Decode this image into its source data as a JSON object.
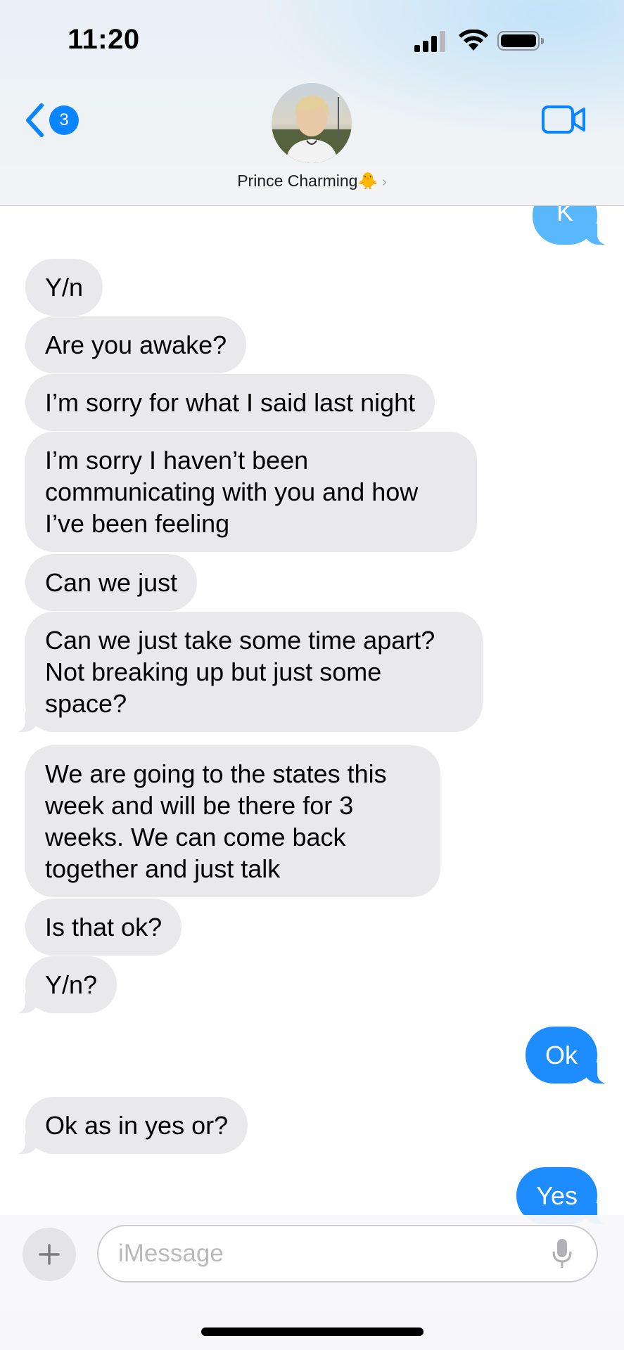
{
  "status_bar": {
    "time": "11:20"
  },
  "header": {
    "back_badge": "3",
    "contact_name": "Prince Charming🐥",
    "chevron": "›"
  },
  "messages": [
    {
      "direction": "outgoing",
      "text": "K"
    },
    {
      "direction": "incoming",
      "text": "Y/n"
    },
    {
      "direction": "incoming",
      "text": "Are you awake?"
    },
    {
      "direction": "incoming",
      "text": "I’m sorry for what I said last night"
    },
    {
      "direction": "incoming",
      "lines": [
        "I’m sorry I haven’t been",
        "communicating with you and how",
        "I’ve been feeling"
      ]
    },
    {
      "direction": "incoming",
      "text": "Can we just"
    },
    {
      "direction": "incoming",
      "lines": [
        "Can we just take some time apart?",
        "Not breaking up but just some",
        "space?"
      ]
    },
    {
      "direction": "incoming",
      "lines": [
        "We are going to the states this",
        "week and will be there for 3",
        "weeks. We can come back",
        "together and just talk"
      ]
    },
    {
      "direction": "incoming",
      "text": "Is that ok?"
    },
    {
      "direction": "incoming",
      "text": "Y/n?"
    },
    {
      "direction": "outgoing",
      "text": "Ok"
    },
    {
      "direction": "incoming",
      "text": "Ok as in yes or?"
    },
    {
      "direction": "outgoing",
      "text": "Yes"
    }
  ],
  "composer": {
    "placeholder": "iMessage"
  },
  "icons": {
    "back": "chevron-left-icon",
    "video": "video-camera-icon",
    "plus": "plus-icon",
    "mic": "microphone-icon"
  },
  "colors": {
    "incoming_bubble": "#e9e9eb",
    "outgoing_bubble": "#1d8cff",
    "accent": "#0a84ff"
  }
}
